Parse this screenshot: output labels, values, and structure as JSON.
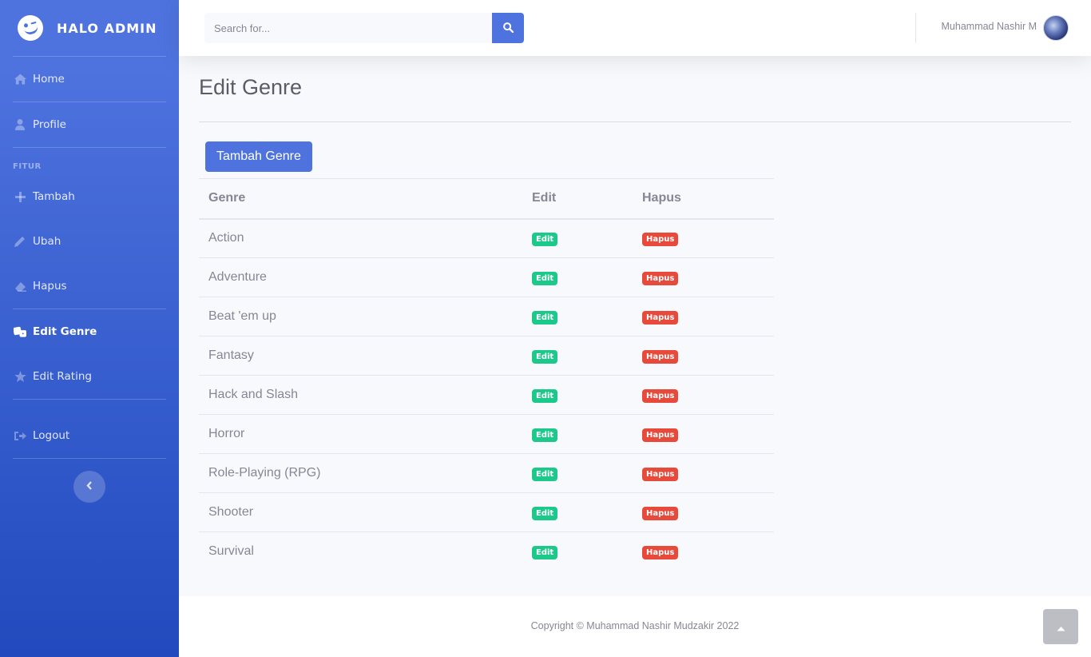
{
  "brand": {
    "name": "HALO ADMIN",
    "icon": "smile-wink-icon"
  },
  "sidebar": {
    "items_top": [
      {
        "label": "Home",
        "icon": "home-icon"
      },
      {
        "label": "Profile",
        "icon": "user-icon"
      }
    ],
    "heading": "FITUR",
    "items_fitur": [
      {
        "label": "Tambah",
        "icon": "plus-icon"
      },
      {
        "label": "Ubah",
        "icon": "pencil-icon"
      },
      {
        "label": "Hapus",
        "icon": "eraser-icon"
      }
    ],
    "items_edit": [
      {
        "label": "Edit Genre",
        "icon": "dice-icon",
        "active": true
      },
      {
        "label": "Edit Rating",
        "icon": "star-icon"
      }
    ],
    "logout": {
      "label": "Logout",
      "icon": "sign-out-icon"
    },
    "toggle_icon": "chevron-left-icon"
  },
  "topbar": {
    "search_placeholder": "Search for...",
    "search_icon": "search-icon",
    "user_name": "Muhammad Nashir M"
  },
  "main": {
    "title": "Edit Genre",
    "add_button": "Tambah Genre",
    "table": {
      "headers": [
        "Genre",
        "Edit",
        "Hapus"
      ],
      "rows": [
        {
          "genre": "Action",
          "edit": "Edit",
          "hapus": "Hapus"
        },
        {
          "genre": "Adventure",
          "edit": "Edit",
          "hapus": "Hapus"
        },
        {
          "genre": "Beat 'em up",
          "edit": "Edit",
          "hapus": "Hapus"
        },
        {
          "genre": "Fantasy",
          "edit": "Edit",
          "hapus": "Hapus"
        },
        {
          "genre": "Hack and Slash",
          "edit": "Edit",
          "hapus": "Hapus"
        },
        {
          "genre": "Horror",
          "edit": "Edit",
          "hapus": "Hapus"
        },
        {
          "genre": "Role-Playing (RPG)",
          "edit": "Edit",
          "hapus": "Hapus"
        },
        {
          "genre": "Shooter",
          "edit": "Edit",
          "hapus": "Hapus"
        },
        {
          "genre": "Survival",
          "edit": "Edit",
          "hapus": "Hapus"
        }
      ]
    }
  },
  "footer": {
    "copyright": "Copyright © Muhammad Nashir Mudzakir 2022"
  },
  "colors": {
    "primary": "#4e73df",
    "success": "#1cc88a",
    "danger": "#e74a3b"
  }
}
